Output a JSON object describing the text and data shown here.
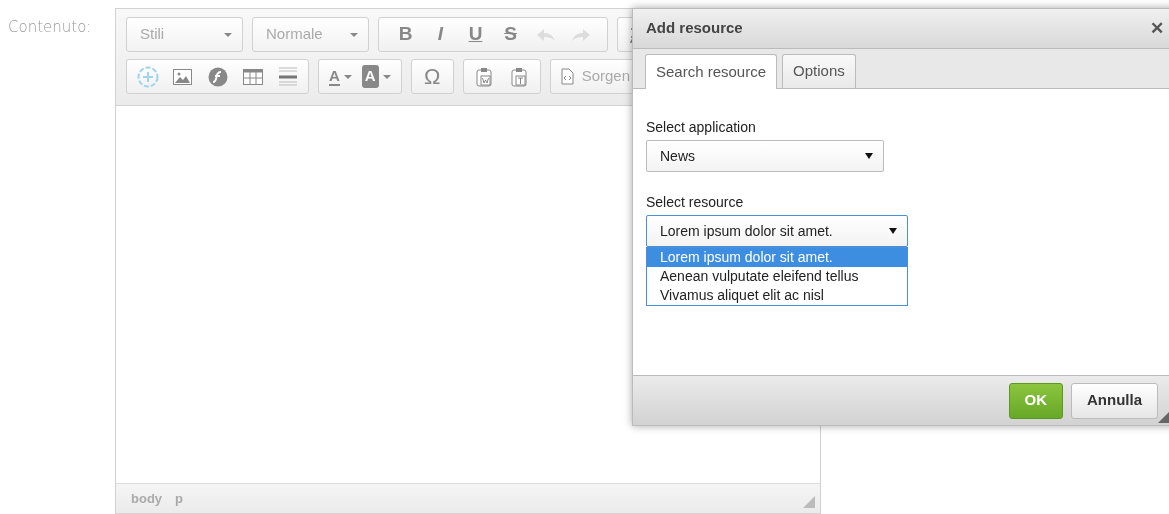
{
  "field_label": "Contenuto:",
  "editor": {
    "combos": [
      {
        "label": "Stili"
      },
      {
        "label": "Normale"
      }
    ],
    "style_buttons": [
      "B",
      "I",
      "U",
      "S"
    ],
    "color_buttons": [
      "A",
      "A"
    ],
    "special_char": "Ω",
    "source_button": "Sorgen",
    "path": [
      "body",
      "p"
    ]
  },
  "dialog": {
    "title": "Add resource",
    "close": "✕",
    "tabs": [
      {
        "label": "Search resource",
        "selected": true
      },
      {
        "label": "Options",
        "selected": false
      }
    ],
    "fields": [
      {
        "label": "Select application",
        "value": "News",
        "expanded": false
      },
      {
        "label": "Select resource",
        "value": "Lorem ipsum dolor sit amet.",
        "expanded": true,
        "options": [
          {
            "label": "Lorem ipsum dolor sit amet.",
            "selected": true
          },
          {
            "label": "Aenean vulputate eleifend tellus",
            "selected": false
          },
          {
            "label": "Vivamus aliquet elit ac nisl",
            "selected": false
          }
        ]
      }
    ],
    "buttons": [
      {
        "label": "OK",
        "kind": "primary"
      },
      {
        "label": "Annulla",
        "kind": "secondary"
      }
    ]
  }
}
